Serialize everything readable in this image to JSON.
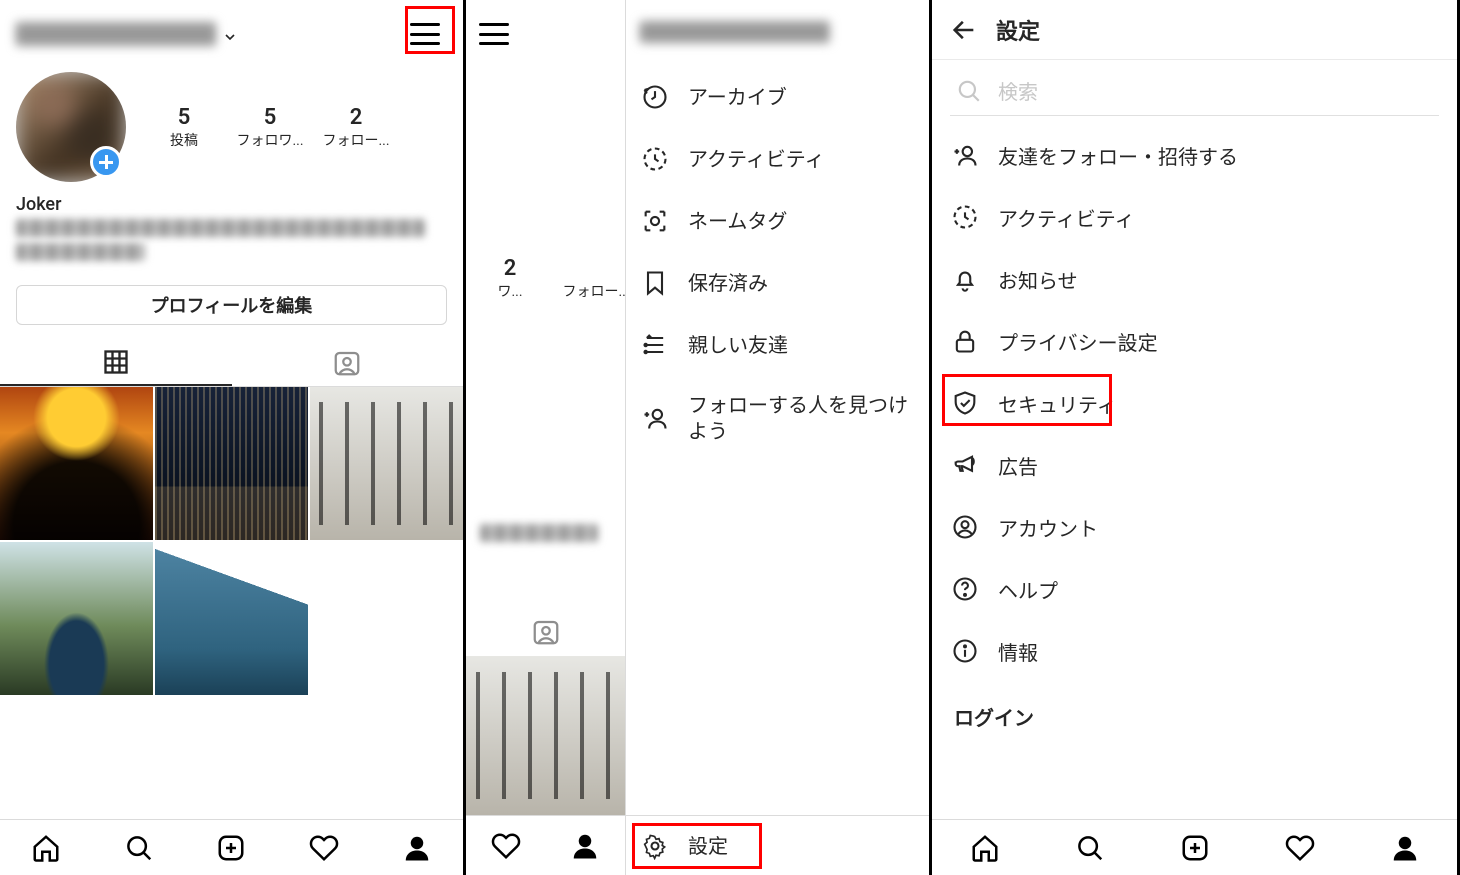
{
  "profile": {
    "display_name": "Joker",
    "stats": {
      "posts": {
        "value": "5",
        "label": "投稿"
      },
      "followers": {
        "value": "5",
        "label": "フォロワ..."
      },
      "following": {
        "value": "2",
        "label": "フォロー..."
      }
    },
    "edit_button": "プロフィールを編集"
  },
  "panel2": {
    "left_stats": {
      "followers": {
        "value": "2",
        "label": "ワ..."
      },
      "following": {
        "label": "フォロー..."
      }
    },
    "menu": [
      {
        "key": "archive",
        "label": "アーカイブ"
      },
      {
        "key": "activity",
        "label": "アクティビティ"
      },
      {
        "key": "nametag",
        "label": "ネームタグ"
      },
      {
        "key": "saved",
        "label": "保存済み"
      },
      {
        "key": "close_friends",
        "label": "親しい友達"
      },
      {
        "key": "discover",
        "label": "フォローする人を見つけよう"
      }
    ],
    "settings_label": "設定"
  },
  "panel3": {
    "title": "設定",
    "search_placeholder": "検索",
    "items": [
      {
        "key": "invite",
        "label": "友達をフォロー・招待する"
      },
      {
        "key": "activity",
        "label": "アクティビティ"
      },
      {
        "key": "notifications",
        "label": "お知らせ"
      },
      {
        "key": "privacy",
        "label": "プライバシー設定"
      },
      {
        "key": "security",
        "label": "セキュリティ"
      },
      {
        "key": "ads",
        "label": "広告"
      },
      {
        "key": "account",
        "label": "アカウント"
      },
      {
        "key": "help",
        "label": "ヘルプ"
      },
      {
        "key": "about",
        "label": "情報"
      }
    ],
    "login_section": "ログイン"
  }
}
